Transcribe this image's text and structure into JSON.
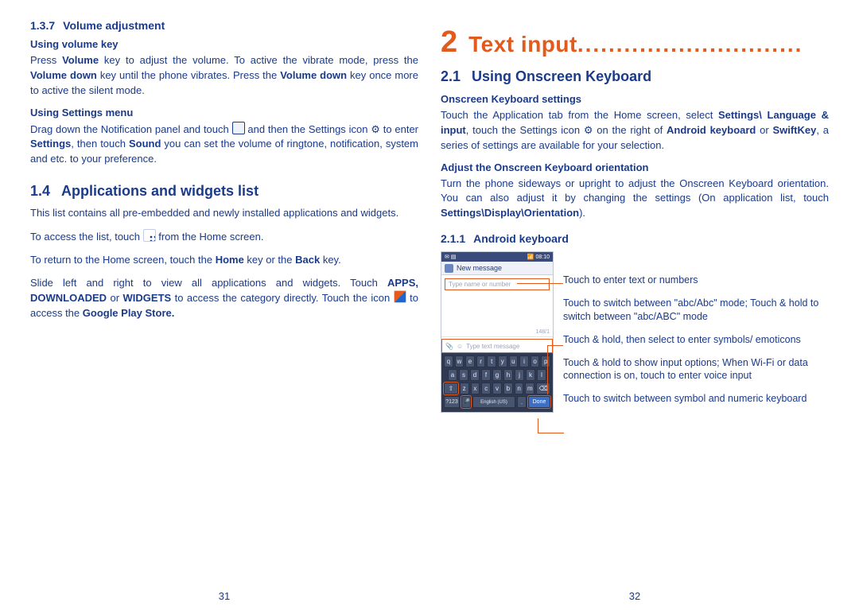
{
  "left": {
    "sec137": {
      "num": "1.3.7",
      "title": "Volume adjustment"
    },
    "sub_vol_key": "Using volume key",
    "p_vol_key_pre": "Press ",
    "p_vol_key_b1": "Volume",
    "p_vol_key_mid1": " key to adjust the volume. To active the vibrate mode, press the ",
    "p_vol_key_b2": "Volume down",
    "p_vol_key_mid2": " key until the phone vibrates. Press the ",
    "p_vol_key_b3": "Volume down",
    "p_vol_key_end": " key once more to active the silent mode.",
    "sub_settings_menu": "Using Settings menu",
    "p_settings_1": "Drag down the Notification panel and touch ",
    "p_settings_2": " and then the Settings icon ",
    "p_settings_3": " to enter ",
    "p_settings_b1": "Settings",
    "p_settings_4": ", then touch ",
    "p_settings_b2": "Sound",
    "p_settings_5": " you can set the volume of ringtone, notification, system and etc. to your preference.",
    "sec14": {
      "num": "1.4",
      "title": "Applications and widgets list"
    },
    "p14_1": "This list contains all pre-embedded and newly installed applications and widgets.",
    "p14_2a": "To access the list, touch ",
    "p14_2b": " from the Home screen.",
    "p14_3a": "To return to the Home screen, touch the ",
    "p14_3b1": "Home",
    "p14_3mid": " key or the ",
    "p14_3b2": "Back",
    "p14_3end": " key.",
    "p14_4a": "Slide left and right to view all applications and widgets. Touch ",
    "p14_4b1": "APPS, DOWNLOADED",
    "p14_4mid": " or ",
    "p14_4b2": "WIDGETS",
    "p14_4c": " to access the category directly. Touch the icon ",
    "p14_4d": " to access the ",
    "p14_4b3": "Google Play Store.",
    "page_num": "31"
  },
  "right": {
    "chapter_num": "2",
    "chapter_title": "Text input",
    "chapter_dots": ".............................",
    "sec21": {
      "num": "2.1",
      "title": "Using Onscreen Keyboard"
    },
    "sub_osk_settings": "Onscreen Keyboard settings",
    "p21_1a": "Touch the Application tab from the Home screen, select ",
    "p21_1b1": "Settings\\ Language & input",
    "p21_1b": ", touch the Settings icon ",
    "p21_1c": " on the right of ",
    "p21_1b2": "Android keyboard",
    "p21_1d": " or ",
    "p21_1b3": "SwiftKey",
    "p21_1e": ", a series of settings are available for your selection.",
    "sub_orientation": "Adjust the Onscreen Keyboard orientation",
    "p_orient_a": "Turn the phone sideways or upright to adjust the Onscreen Keyboard orientation. You can also adjust it by changing the settings (On application list, touch ",
    "p_orient_b": "Settings\\Display\\Orientation",
    "p_orient_c": ").",
    "sec211": {
      "num": "2.1.1",
      "title": "Android keyboard"
    },
    "phone": {
      "time": "08:10",
      "new_message": "New message",
      "input_placeholder": "Type name or number",
      "counter": "148/1",
      "attach_placeholder": "Type text message",
      "keys_r1": [
        "q",
        "w",
        "e",
        "r",
        "t",
        "y",
        "u",
        "i",
        "o",
        "p"
      ],
      "keys_r2": [
        "a",
        "s",
        "d",
        "f",
        "g",
        "h",
        "j",
        "k",
        "l"
      ],
      "keys_r3_shift": "⇧",
      "keys_r3": [
        "z",
        "x",
        "c",
        "v",
        "b",
        "n",
        "m"
      ],
      "keys_r3_del": "⌫",
      "k_num": "?123",
      "k_mic": "🎤",
      "k_space": "English (US)",
      "k_dot": ".",
      "k_done": "Done"
    },
    "callouts": {
      "c1": "Touch to enter text or numbers",
      "c2": "Touch to switch between \"abc/Abc\" mode; Touch & hold to switch between \"abc/ABC\" mode",
      "c3": "Touch & hold, then select to enter symbols/ emoticons",
      "c4": "Touch & hold to show input options; When Wi-Fi or data connection is on, touch to enter voice input",
      "c5": "Touch to switch between symbol and numeric keyboard"
    },
    "page_num": "32"
  }
}
